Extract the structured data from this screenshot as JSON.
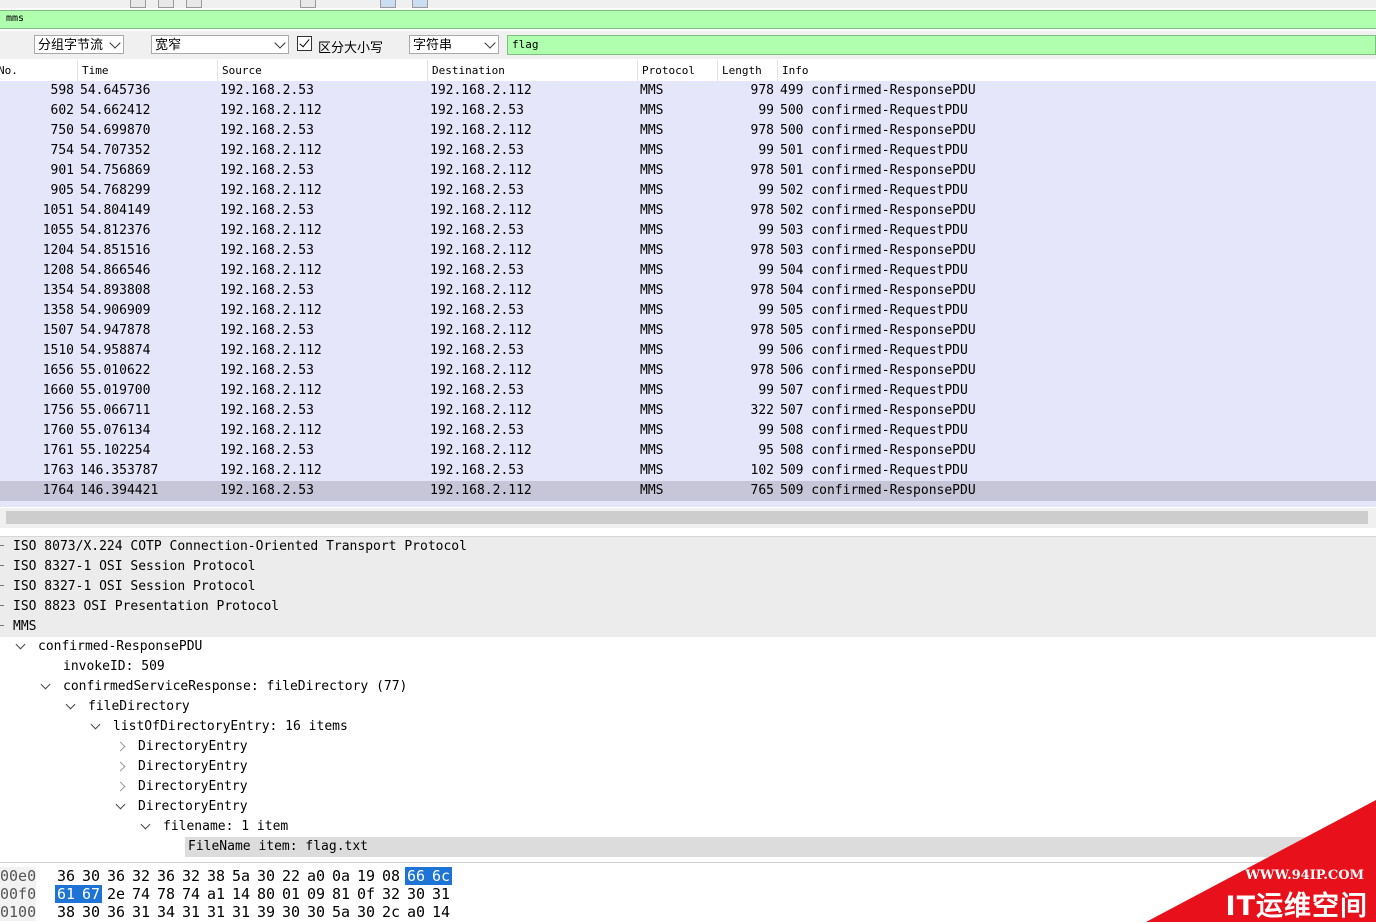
{
  "display_filter": {
    "value": "mms"
  },
  "find_bar": {
    "search_in": "分组字节流",
    "char_width": "宽窄",
    "case_sensitive_label": "区分大小写",
    "search_type": "字符串",
    "search_value": "flag"
  },
  "packet_list": {
    "columns": [
      "No.",
      "Time",
      "Source",
      "Destination",
      "Protocol",
      "Length",
      "Info"
    ],
    "rows": [
      {
        "no": "598",
        "time": "54.645736",
        "src": "192.168.2.53",
        "dst": "192.168.2.112",
        "proto": "MMS",
        "len": "978",
        "info": "499 confirmed-ResponsePDU"
      },
      {
        "no": "602",
        "time": "54.662412",
        "src": "192.168.2.112",
        "dst": "192.168.2.53",
        "proto": "MMS",
        "len": "99",
        "info": "500 confirmed-RequestPDU"
      },
      {
        "no": "750",
        "time": "54.699870",
        "src": "192.168.2.53",
        "dst": "192.168.2.112",
        "proto": "MMS",
        "len": "978",
        "info": "500 confirmed-ResponsePDU"
      },
      {
        "no": "754",
        "time": "54.707352",
        "src": "192.168.2.112",
        "dst": "192.168.2.53",
        "proto": "MMS",
        "len": "99",
        "info": "501 confirmed-RequestPDU"
      },
      {
        "no": "901",
        "time": "54.756869",
        "src": "192.168.2.53",
        "dst": "192.168.2.112",
        "proto": "MMS",
        "len": "978",
        "info": "501 confirmed-ResponsePDU"
      },
      {
        "no": "905",
        "time": "54.768299",
        "src": "192.168.2.112",
        "dst": "192.168.2.53",
        "proto": "MMS",
        "len": "99",
        "info": "502 confirmed-RequestPDU"
      },
      {
        "no": "1051",
        "time": "54.804149",
        "src": "192.168.2.53",
        "dst": "192.168.2.112",
        "proto": "MMS",
        "len": "978",
        "info": "502 confirmed-ResponsePDU"
      },
      {
        "no": "1055",
        "time": "54.812376",
        "src": "192.168.2.112",
        "dst": "192.168.2.53",
        "proto": "MMS",
        "len": "99",
        "info": "503 confirmed-RequestPDU"
      },
      {
        "no": "1204",
        "time": "54.851516",
        "src": "192.168.2.53",
        "dst": "192.168.2.112",
        "proto": "MMS",
        "len": "978",
        "info": "503 confirmed-ResponsePDU"
      },
      {
        "no": "1208",
        "time": "54.866546",
        "src": "192.168.2.112",
        "dst": "192.168.2.53",
        "proto": "MMS",
        "len": "99",
        "info": "504 confirmed-RequestPDU"
      },
      {
        "no": "1354",
        "time": "54.893808",
        "src": "192.168.2.53",
        "dst": "192.168.2.112",
        "proto": "MMS",
        "len": "978",
        "info": "504 confirmed-ResponsePDU"
      },
      {
        "no": "1358",
        "time": "54.906909",
        "src": "192.168.2.112",
        "dst": "192.168.2.53",
        "proto": "MMS",
        "len": "99",
        "info": "505 confirmed-RequestPDU"
      },
      {
        "no": "1507",
        "time": "54.947878",
        "src": "192.168.2.53",
        "dst": "192.168.2.112",
        "proto": "MMS",
        "len": "978",
        "info": "505 confirmed-ResponsePDU"
      },
      {
        "no": "1510",
        "time": "54.958874",
        "src": "192.168.2.112",
        "dst": "192.168.2.53",
        "proto": "MMS",
        "len": "99",
        "info": "506 confirmed-RequestPDU"
      },
      {
        "no": "1656",
        "time": "55.010622",
        "src": "192.168.2.53",
        "dst": "192.168.2.112",
        "proto": "MMS",
        "len": "978",
        "info": "506 confirmed-ResponsePDU"
      },
      {
        "no": "1660",
        "time": "55.019700",
        "src": "192.168.2.112",
        "dst": "192.168.2.53",
        "proto": "MMS",
        "len": "99",
        "info": "507 confirmed-RequestPDU"
      },
      {
        "no": "1756",
        "time": "55.066711",
        "src": "192.168.2.53",
        "dst": "192.168.2.112",
        "proto": "MMS",
        "len": "322",
        "info": "507 confirmed-ResponsePDU"
      },
      {
        "no": "1760",
        "time": "55.076134",
        "src": "192.168.2.112",
        "dst": "192.168.2.53",
        "proto": "MMS",
        "len": "99",
        "info": "508 confirmed-RequestPDU"
      },
      {
        "no": "1761",
        "time": "55.102254",
        "src": "192.168.2.53",
        "dst": "192.168.2.112",
        "proto": "MMS",
        "len": "95",
        "info": "508 confirmed-ResponsePDU"
      },
      {
        "no": "1763",
        "time": "146.353787",
        "src": "192.168.2.112",
        "dst": "192.168.2.53",
        "proto": "MMS",
        "len": "102",
        "info": "509 confirmed-RequestPDU"
      },
      {
        "no": "1764",
        "time": "146.394421",
        "src": "192.168.2.53",
        "dst": "192.168.2.112",
        "proto": "MMS",
        "len": "765",
        "info": "509 confirmed-ResponsePDU"
      }
    ],
    "selected_no": "1764"
  },
  "detail_tree": {
    "items": [
      {
        "text": "ISO 8073/X.224 COTP Connection-Oriented Transport Protocol",
        "depth": 0,
        "expander": "none"
      },
      {
        "text": "ISO 8327-1 OSI Session Protocol",
        "depth": 0,
        "expander": "none"
      },
      {
        "text": "ISO 8327-1 OSI Session Protocol",
        "depth": 0,
        "expander": "none"
      },
      {
        "text": "ISO 8823 OSI Presentation Protocol",
        "depth": 0,
        "expander": "none"
      },
      {
        "text": "MMS",
        "depth": 0,
        "expander": "none"
      },
      {
        "text": "confirmed-ResponsePDU",
        "depth": 1,
        "expander": "down"
      },
      {
        "text": "invokeID: 509",
        "depth": 2,
        "expander": "none"
      },
      {
        "text": "confirmedServiceResponse: fileDirectory (77)",
        "depth": 2,
        "expander": "down"
      },
      {
        "text": "fileDirectory",
        "depth": 3,
        "expander": "down"
      },
      {
        "text": "listOfDirectoryEntry: 16 items",
        "depth": 4,
        "expander": "down"
      },
      {
        "text": "DirectoryEntry",
        "depth": 5,
        "expander": "right"
      },
      {
        "text": "DirectoryEntry",
        "depth": 5,
        "expander": "right"
      },
      {
        "text": "DirectoryEntry",
        "depth": 5,
        "expander": "right"
      },
      {
        "text": "DirectoryEntry",
        "depth": 5,
        "expander": "down"
      },
      {
        "text": "filename: 1 item",
        "depth": 6,
        "expander": "down"
      },
      {
        "text": "FileName item: flag.txt",
        "depth": 7,
        "expander": "none"
      }
    ]
  },
  "bytes_pane": {
    "rows": [
      {
        "offset": "00e0",
        "bytes": [
          "36",
          "30",
          "36",
          "32",
          "36",
          "32",
          "38",
          "5a",
          "30",
          "22",
          "a0",
          "0a",
          "19",
          "08",
          "66",
          "6c"
        ],
        "highlight": [
          14,
          15
        ]
      },
      {
        "offset": "00f0",
        "bytes": [
          "61",
          "67",
          "2e",
          "74",
          "78",
          "74",
          "a1",
          "14",
          "80",
          "01",
          "09",
          "81",
          "0f",
          "32",
          "30",
          "31"
        ],
        "highlight": [
          0,
          1
        ]
      },
      {
        "offset": "0100",
        "bytes": [
          "38",
          "30",
          "36",
          "31",
          "34",
          "31",
          "31",
          "31",
          "39",
          "30",
          "30",
          "5a",
          "30",
          "2c",
          "a0",
          "14"
        ],
        "highlight": []
      }
    ]
  },
  "watermark": {
    "url": "WWW.94IP.COM",
    "brand": "IT运维空间",
    "color": "#e8101a"
  },
  "colors": {
    "filter_ok": "#afffaf",
    "row_bg": "#e6e6fa",
    "row_selected": "#c6c6d8",
    "hex_highlight": "#1e74d6"
  }
}
